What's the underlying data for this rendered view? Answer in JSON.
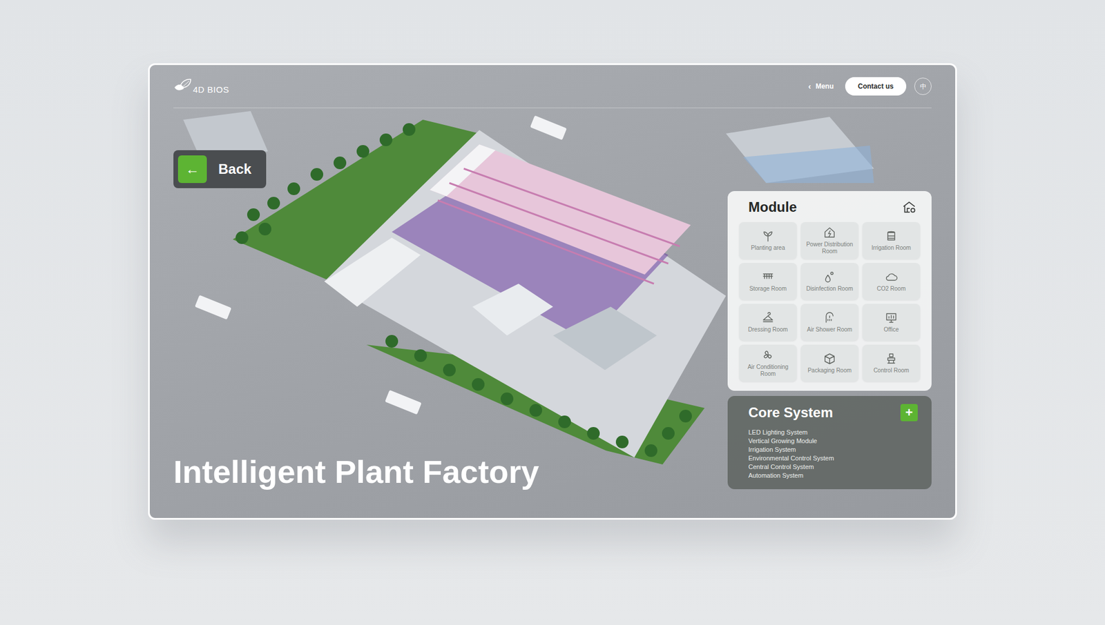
{
  "header": {
    "logo": "4D BIOS",
    "menu_icon": "‹",
    "menu": "Menu",
    "contact": "Contact us",
    "language": "中"
  },
  "back": {
    "icon": "←",
    "label": "Back"
  },
  "title": "Intelligent Plant Factory",
  "module": {
    "title": "Module",
    "items": [
      {
        "label": "Planting area"
      },
      {
        "label": "Power Distribution Room"
      },
      {
        "label": "Irrigation Room"
      },
      {
        "label": "Storage Room"
      },
      {
        "label": "Disinfection Room"
      },
      {
        "label": "CO2 Room"
      },
      {
        "label": "Dressing Room"
      },
      {
        "label": "Air Shower Room"
      },
      {
        "label": "Office"
      },
      {
        "label": "Air Conditioning Room"
      },
      {
        "label": "Packaging Room"
      },
      {
        "label": "Control Room"
      }
    ]
  },
  "core_system": {
    "title": "Core System",
    "toggle": "+",
    "items": [
      "LED Lighting System",
      "Vertical Growing Module",
      "Irrigation System",
      "Environmental Control System",
      "Central Control System",
      "Automation System"
    ]
  }
}
